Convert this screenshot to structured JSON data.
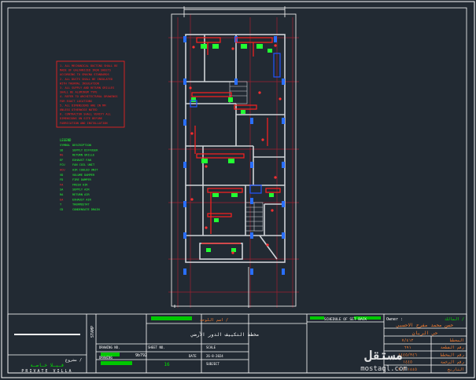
{
  "colors": {
    "background": "#222a33",
    "frame": "#ffffff",
    "wall": "#cfd3d8",
    "hvac_red": "#ff2020",
    "hvac_green": "#22ff33",
    "duct_blue": "#2255ff",
    "column": "#2a6fff",
    "grid_red": "#a02030",
    "title_green": "#00e600"
  },
  "general_notes": [
    "1. ALL MECHANICAL DUCTING SHALL BE",
    "MADE OF GALVANIZED IRON SHEETS",
    "ACCORDING TO SMACNA STANDARDS",
    "2. ALL DUCTS SHALL BE INSULATED",
    "WITH THERMAL INSULATION",
    "3. ALL SUPPLY AND RETURN GRILLES",
    "SHALL BE ALUMINUM TYPE",
    "4. REFER TO ARCHITECTURAL DRAWINGS",
    "FOR EXACT LOCATIONS",
    "5. ALL DIMENSIONS ARE IN MM",
    "UNLESS OTHERWISE NOTED",
    "6. CONTRACTOR SHALL VERIFY ALL",
    "DIMENSIONS ON SITE BEFORE",
    "FABRICATION AND INSTALLATION"
  ],
  "legend": {
    "header": "LEGEND",
    "items": [
      {
        "symbol": "SYMBOL",
        "text": "DESCRIPTION"
      },
      {
        "symbol": "SD",
        "text": "SUPPLY DIFFUSER"
      },
      {
        "symbol": "RG",
        "text": "RETURN GRILLE"
      },
      {
        "symbol": "EF",
        "text": "EXHAUST FAN"
      },
      {
        "symbol": "FCU",
        "text": "FAN COIL UNIT"
      },
      {
        "symbol": "ACU",
        "text": "AIR COOLED UNIT"
      },
      {
        "symbol": "VD",
        "text": "VOLUME DAMPER"
      },
      {
        "symbol": "FD",
        "text": "FIRE DAMPER"
      },
      {
        "symbol": "FA",
        "text": "FRESH AIR"
      },
      {
        "symbol": "SA",
        "text": "SUPPLY AIR"
      },
      {
        "symbol": "RA",
        "text": "RETURN AIR"
      },
      {
        "symbol": "EA",
        "text": "EXHAUST AIR"
      },
      {
        "symbol": "T",
        "text": "THERMOSTAT"
      },
      {
        "symbol": "CD",
        "text": "CONDENSATE DRAIN"
      }
    ]
  },
  "title_block": {
    "project_label": "مشروع /",
    "project_name": "فـيـلا خـاصـة",
    "project_en": "PRIVATE VILLA",
    "stamp_label": "STAMP",
    "sheet_title_label": "اسم اللوحة /",
    "sheet_title": "مخطط التكييف الدور الأرضي",
    "drawing_no_label": "DRAWING NO.",
    "drawing_no": "9b792",
    "drawing_label": "DRAWING",
    "sheet_no_label": "SHEET NO.",
    "sheet_no": "16",
    "scale_label": "SCALE",
    "date_label": "DATE",
    "date_value": "26-8-2024",
    "subject_label": "SUBJECT",
    "schedule_label": "SCHEDULE OF SET BACK",
    "owner_label": "Owner :",
    "owner_ar": "المالك /",
    "owner_name": "حسن محمد مفرح الاحسبي",
    "district": "حي الريان",
    "info_rows": [
      {
        "label": "المخطط",
        "value": "٧/٤١٢"
      },
      {
        "label": "رقم القطعة",
        "value": "٦٩١"
      },
      {
        "label": "رقم المخطط",
        "value": "١٤٤٥/٣٤٦"
      },
      {
        "label": "رقم الرخصة",
        "value": "١٤٤٥"
      },
      {
        "label": "التاريخ",
        "value": "١٤٤٥ / ٢"
      }
    ]
  },
  "watermark": {
    "brand_ar": "مستقل",
    "brand_url": "mostaql.com"
  }
}
